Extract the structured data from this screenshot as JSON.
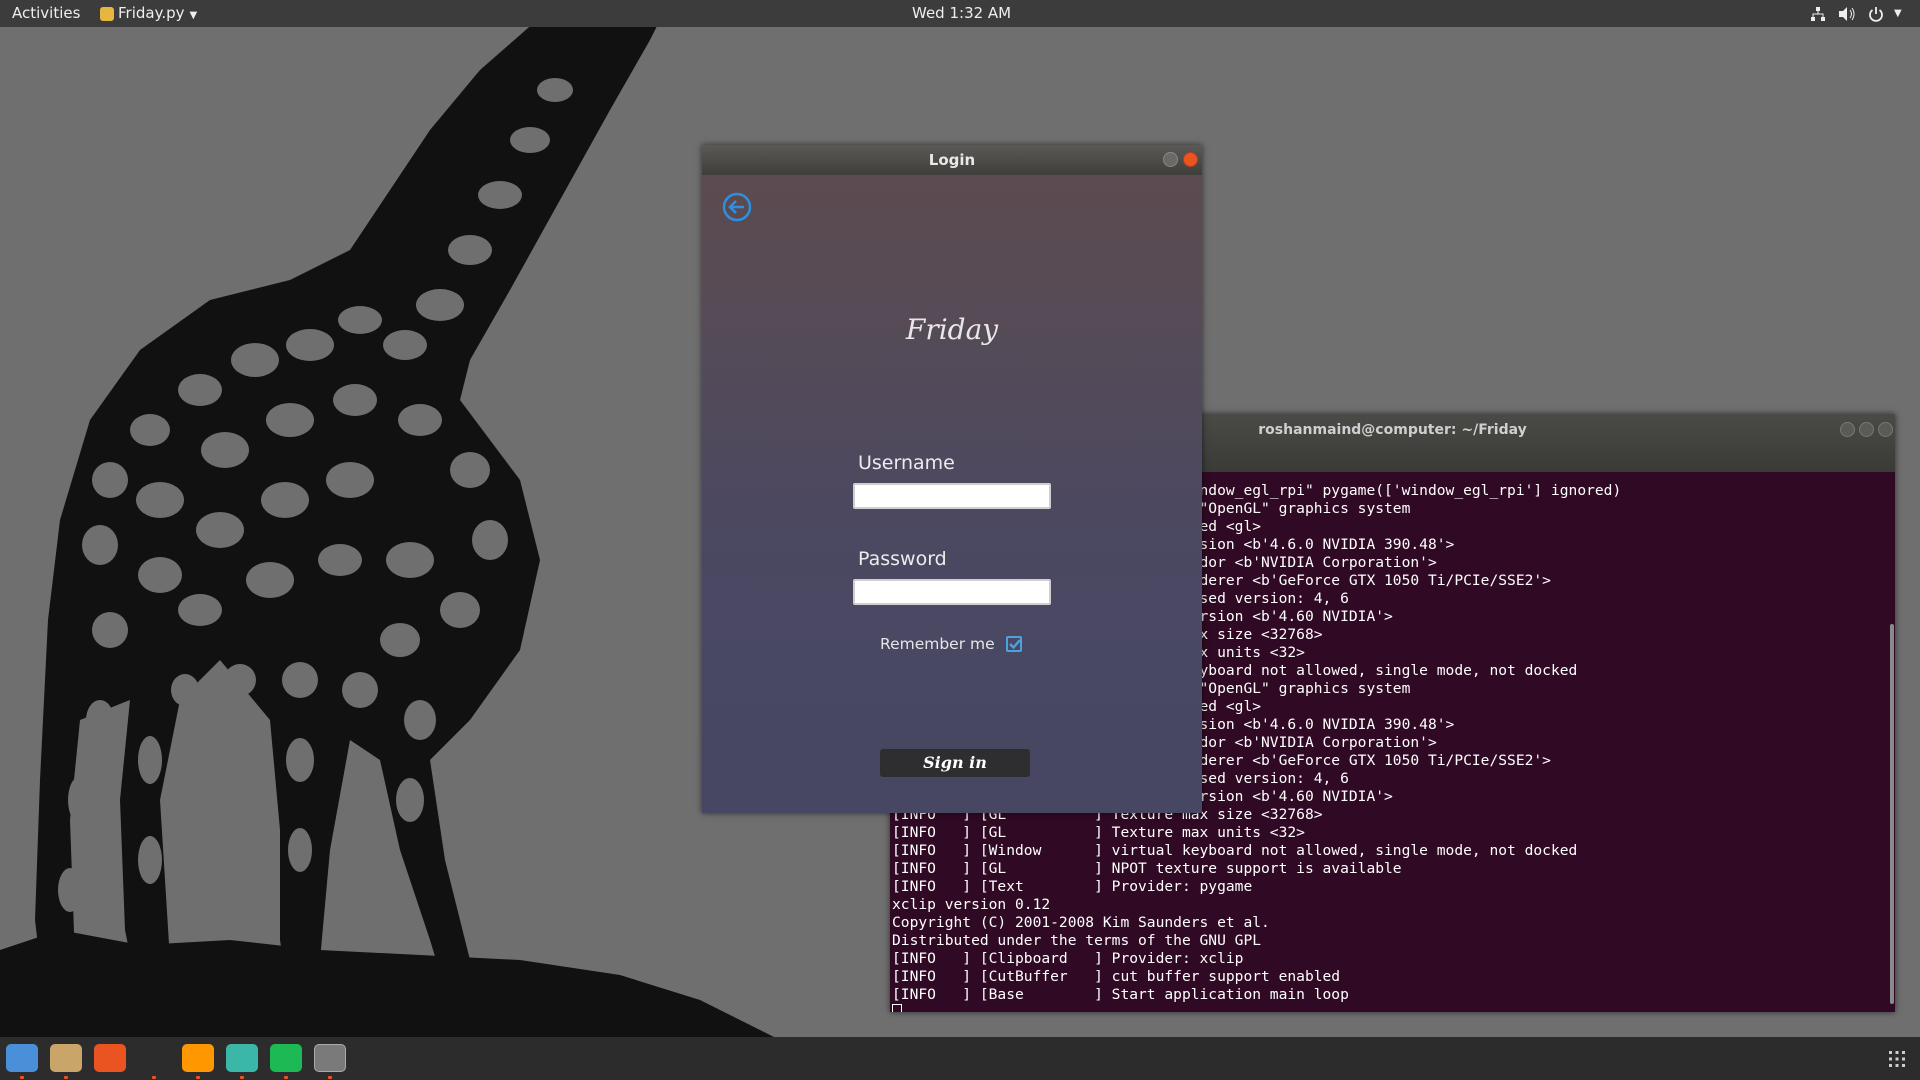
{
  "top_bar": {
    "activities": "Activities",
    "app_menu": "Friday.py",
    "clock": "Wed  1:32 AM"
  },
  "login": {
    "title": "Login",
    "brand": "Friday",
    "username_label": "Username",
    "username_value": "",
    "password_label": "Password",
    "password_value": "",
    "remember_label": "Remember me",
    "remember_checked": true,
    "sign_in": "Sign in"
  },
  "terminal": {
    "title": "roshanmaind@computer: ~/Friday",
    "lines": [
      "[INFO   ] [Kivy        ] Option \"window_egl_rpi\" pygame(['window_egl_rpi'] ignored)",
      "[INFO   ] [GL          ] Using the \"OpenGL\" graphics system",
      "[INFO   ] [GL          ] Backend used <gl>",
      "[INFO   ] [GL          ] OpenGL version <b'4.6.0 NVIDIA 390.48'>",
      "[INFO   ] [GL          ] OpenGL vendor <b'NVIDIA Corporation'>",
      "[INFO   ] [GL          ] OpenGL renderer <b'GeForce GTX 1050 Ti/PCIe/SSE2'>",
      "[INFO   ] [GL          ] OpenGL parsed version: 4, 6",
      "[INFO   ] [GL          ] Shading version <b'4.60 NVIDIA'>",
      "[INFO   ] [GL          ] Texture max size <32768>",
      "[INFO   ] [GL          ] Texture max units <32>",
      "[INFO   ] [Window      ] virtual keyboard not allowed, single mode, not docked",
      "[INFO   ] [GL          ] Using the \"OpenGL\" graphics system",
      "[INFO   ] [GL          ] Backend used <gl>",
      "[INFO   ] [GL          ] OpenGL version <b'4.6.0 NVIDIA 390.48'>",
      "[INFO   ] [GL          ] OpenGL vendor <b'NVIDIA Corporation'>",
      "[INFO   ] [GL          ] OpenGL renderer <b'GeForce GTX 1050 Ti/PCIe/SSE2'>",
      "[INFO   ] [GL          ] OpenGL parsed version: 4, 6",
      "[INFO   ] [GL          ] Shading version <b'4.60 NVIDIA'>",
      "[INFO   ] [GL          ] Texture max size <32768>",
      "[INFO   ] [GL          ] Texture max units <32>",
      "[INFO   ] [Window      ] virtual keyboard not allowed, single mode, not docked",
      "[INFO   ] [GL          ] NPOT texture support is available",
      "[INFO   ] [Text        ] Provider: pygame",
      "xclip version 0.12",
      "Copyright (C) 2001-2008 Kim Saunders et al.",
      "Distributed under the terms of the GNU GPL",
      "[INFO   ] [Clipboard   ] Provider: xclip",
      "[INFO   ] [CutBuffer   ] cut buffer support enabled",
      "[INFO   ] [Base        ] Start application main loop"
    ]
  },
  "dock": [
    {
      "name": "chromium-icon",
      "color": "#4a90d9",
      "running": true
    },
    {
      "name": "files-icon",
      "color": "#c9a56a",
      "running": true
    },
    {
      "name": "software-center-icon",
      "color": "#e95420",
      "running": false
    },
    {
      "name": "terminal-icon",
      "color": "#2c2c2c",
      "running": true
    },
    {
      "name": "sublime-text-icon",
      "color": "#ff9800",
      "running": true
    },
    {
      "name": "atom-icon",
      "color": "#3bb7a8",
      "running": true
    },
    {
      "name": "spotify-icon",
      "color": "#1db954",
      "running": true
    },
    {
      "name": "kivy-app-icon",
      "color": "#7a7a7a",
      "running": true
    }
  ],
  "colors": {
    "terminal_bg": "#300a24",
    "accent": "#e95420",
    "checkbox": "#4aa3df"
  }
}
